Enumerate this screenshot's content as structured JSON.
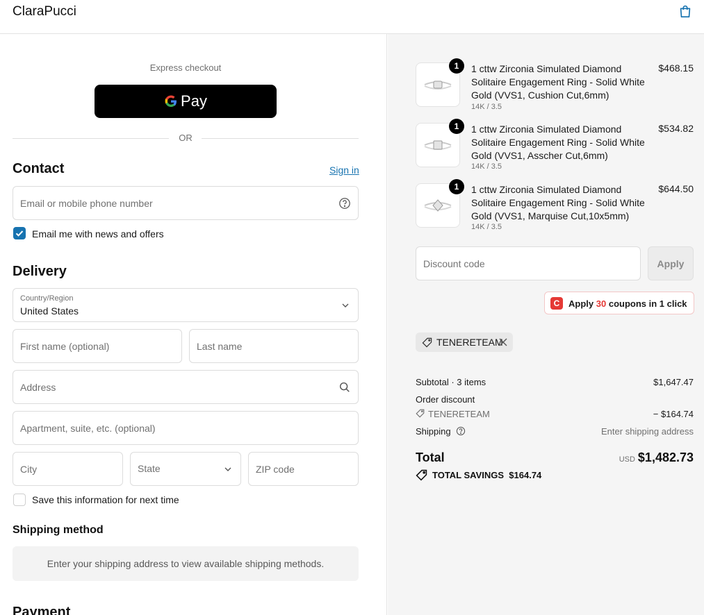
{
  "header": {
    "brand": "ClaraPucci",
    "cart_icon": "shopping-bag-icon"
  },
  "express": {
    "label": "Express checkout",
    "gpay_label": "Pay",
    "or_label": "OR"
  },
  "contact": {
    "title": "Contact",
    "sign_in": "Sign in",
    "email_placeholder": "Email or mobile phone number",
    "newsletter_label": "Email me with news and offers",
    "newsletter_checked": true
  },
  "delivery": {
    "title": "Delivery",
    "country_label": "Country/Region",
    "country_value": "United States",
    "first_name_placeholder": "First name (optional)",
    "last_name_placeholder": "Last name",
    "address_placeholder": "Address",
    "apartment_placeholder": "Apartment, suite, etc. (optional)",
    "city_placeholder": "City",
    "state_label": "State",
    "zip_placeholder": "ZIP code",
    "save_info_label": "Save this information for next time",
    "save_info_checked": false
  },
  "shipping": {
    "title": "Shipping method",
    "message": "Enter your shipping address to view available shipping methods."
  },
  "payment": {
    "title": "Payment"
  },
  "cart": {
    "items": [
      {
        "qty": "1",
        "name": "1 cttw Zirconia Simulated Diamond Solitaire Engagement Ring - Solid White Gold (VVS1, Cushion Cut,6mm)",
        "variant": "14K / 3.5",
        "price": "$468.15"
      },
      {
        "qty": "1",
        "name": "1 cttw Zirconia Simulated Diamond Solitaire Engagement Ring - Solid White Gold (VVS1, Asscher Cut,6mm)",
        "variant": "14K / 3.5",
        "price": "$534.82"
      },
      {
        "qty": "1",
        "name": "1 cttw Zirconia Simulated Diamond Solitaire Engagement Ring - Solid White Gold (VVS1, Marquise Cut,10x5mm)",
        "variant": "14K / 3.5",
        "price": "$644.50"
      }
    ],
    "discount_placeholder": "Discount code",
    "apply_label": "Apply",
    "coupon_prefix": "Apply",
    "coupon_count": "30",
    "coupon_suffix": "coupons in 1 click",
    "applied_code": "TENERETEAM",
    "subtotal_label": "Subtotal · 3 items",
    "subtotal_value": "$1,647.47",
    "order_discount_label": "Order discount",
    "order_discount_code": "TENERETEAM",
    "order_discount_value": "− $164.74",
    "shipping_label": "Shipping",
    "shipping_value": "Enter shipping address",
    "total_label": "Total",
    "total_currency": "USD",
    "total_value": "$1,482.73",
    "savings_label": "TOTAL SAVINGS",
    "savings_value": "$164.74"
  },
  "colors": {
    "accent": "#1773b0",
    "coupon_red": "#e53935"
  }
}
